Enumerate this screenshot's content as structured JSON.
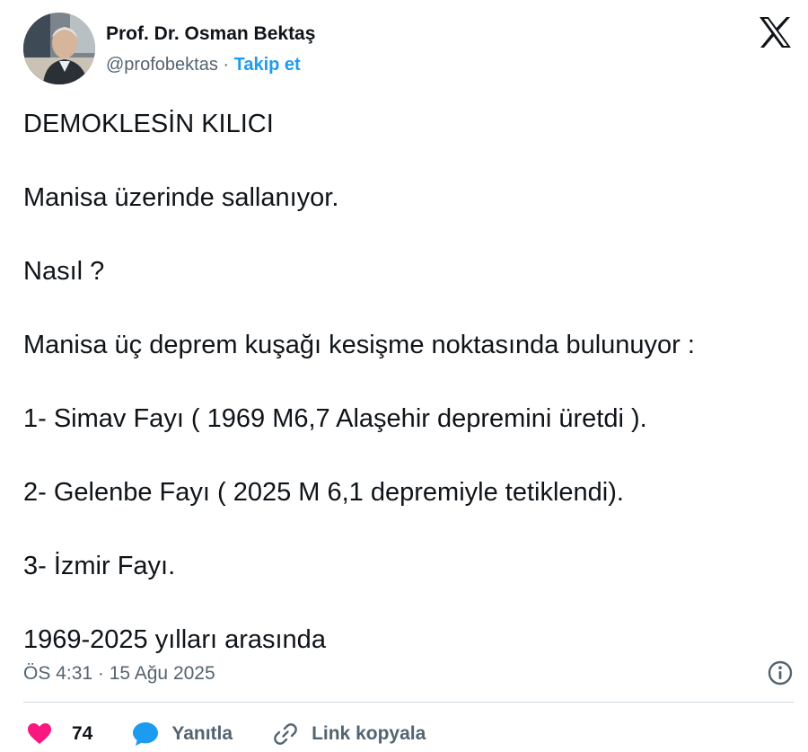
{
  "author": {
    "name": "Prof. Dr. Osman Bektaş",
    "handle": "@profobektas",
    "separator": " · ",
    "follow_label": "Takip et"
  },
  "brand": {
    "logo_icon": "x-logo-icon"
  },
  "tweet": {
    "paragraphs": [
      "DEMOKLESİN KILICI",
      "Manisa üzerinde sallanıyor.",
      "Nasıl ?",
      "Manisa üç deprem kuşağı kesişme noktasında bulunuyor  :",
      "1- Simav Fayı ( 1969 M6,7 Alaşehir depremini üretdi ).",
      "2- Gelenbe Fayı ( 2025 M 6,1 depremiyle tetiklendi).",
      "3- İzmir Fayı.",
      "1969-2025 yılları arasında"
    ],
    "timestamp": "ÖS 4:31 · 15 Ağu 2025"
  },
  "actions": {
    "like_count": "74",
    "reply_label": "Yanıtla",
    "copy_link_label": "Link kopyala"
  },
  "colors": {
    "accent": "#1d9bf0",
    "like": "#f91880",
    "secondary_text": "#536471",
    "divider": "#cfd9de"
  }
}
